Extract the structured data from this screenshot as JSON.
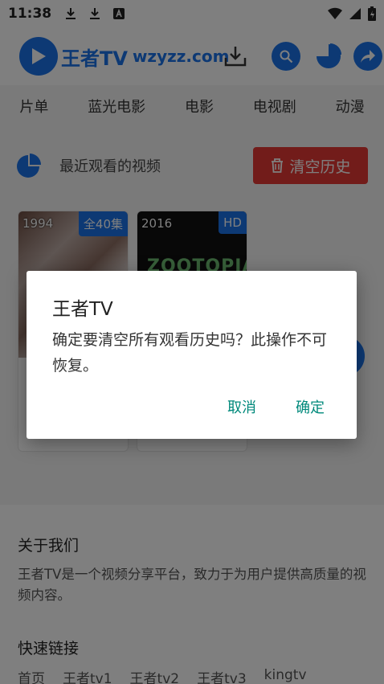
{
  "status_bar": {
    "time": "11:38"
  },
  "header": {
    "site_name": "王者TV",
    "site_domain": "wzyzz.com"
  },
  "nav": {
    "items": [
      "片单",
      "蓝光电影",
      "电影",
      "电视剧",
      "动漫"
    ]
  },
  "history": {
    "title": "最近观看的视频",
    "clear_label": "清空历史"
  },
  "cards": [
    {
      "year": "1994",
      "badge": "全40集"
    },
    {
      "year": "2016",
      "badge": "HD",
      "poster_text": "ZOOTOPIA"
    }
  ],
  "footer": {
    "about_title": "关于我们",
    "about_text": "王者TV是一个视频分享平台，致力于为用户提供高质量的视频内容。",
    "links_title": "快速链接",
    "links": [
      "首页",
      "王者tv1",
      "王者tv2",
      "王者tv3",
      "kingtv"
    ]
  },
  "dialog": {
    "title": "王者TV",
    "message": "确定要清空所有观看历史吗？此操作不可恢复。",
    "cancel_label": "取消",
    "confirm_label": "确定"
  },
  "colors": {
    "brand": "#1a73e8",
    "danger": "#e53935",
    "dialog_button": "#00897b"
  }
}
